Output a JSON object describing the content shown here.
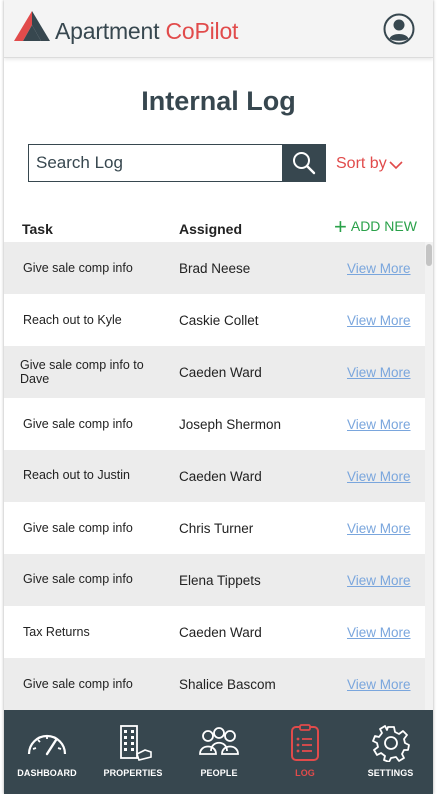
{
  "header": {
    "brand_main": "Apartment ",
    "brand_accent": "CoPilot"
  },
  "page_title": "Internal Log",
  "search": {
    "placeholder": "Search Log",
    "value": ""
  },
  "sort_label": "Sort by",
  "add_new_label": "ADD NEW",
  "columns": {
    "task": "Task",
    "assigned": "Assigned"
  },
  "rows": [
    {
      "task": "Give sale comp info",
      "assigned": "Brad Neese",
      "link": "View More"
    },
    {
      "task": "Reach out to Kyle",
      "assigned": "Caskie Collet",
      "link": "View More"
    },
    {
      "task": "Give sale comp info to Dave",
      "assigned": "Caeden Ward",
      "link": "View More"
    },
    {
      "task": "Give sale comp info",
      "assigned": "Joseph Shermon",
      "link": "View More"
    },
    {
      "task": "Reach out to Justin",
      "assigned": "Caeden Ward",
      "link": "View More"
    },
    {
      "task": "Give sale comp info",
      "assigned": "Chris Turner",
      "link": "View More"
    },
    {
      "task": "Give sale comp info",
      "assigned": "Elena Tippets",
      "link": "View More"
    },
    {
      "task": "Tax Returns",
      "assigned": "Caeden Ward",
      "link": "View More"
    },
    {
      "task": "Give sale comp info",
      "assigned": "Shalice Bascom",
      "link": "View More"
    }
  ],
  "nav": [
    {
      "label": "DASHBOARD",
      "icon": "speedometer-icon"
    },
    {
      "label": "PROPERTIES",
      "icon": "building-icon"
    },
    {
      "label": "PEOPLE",
      "icon": "people-icon"
    },
    {
      "label": "LOG",
      "icon": "log-icon",
      "active": true
    },
    {
      "label": "SETTINGS",
      "icon": "gear-icon"
    }
  ],
  "colors": {
    "accent": "#e14b4b",
    "dark": "#37474f",
    "green": "#2aa14a",
    "link": "#7aa6dd"
  }
}
